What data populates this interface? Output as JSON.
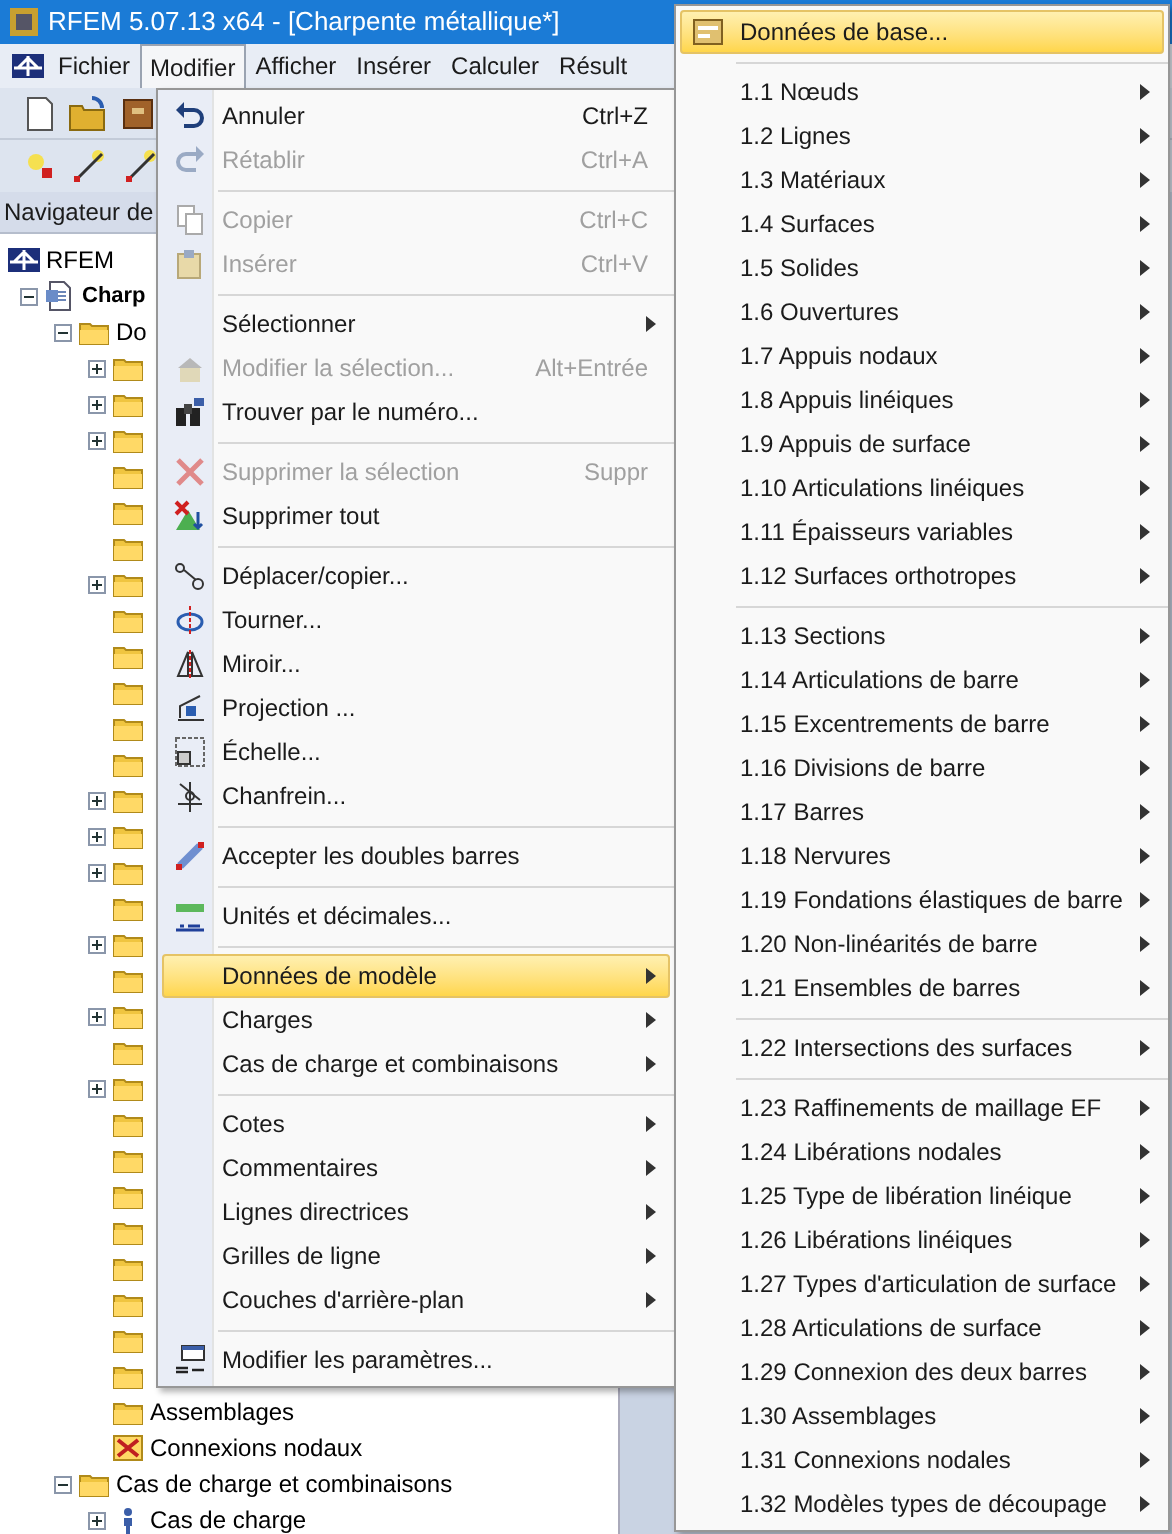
{
  "window": {
    "title": "RFEM 5.07.13 x64 - [Charpente métallique*]"
  },
  "menu_bar": [
    {
      "label": "Fichier",
      "selected": false
    },
    {
      "label": "Modifier",
      "selected": true
    },
    {
      "label": "Afficher",
      "selected": false
    },
    {
      "label": "Insérer",
      "selected": false
    },
    {
      "label": "Calculer",
      "selected": false
    },
    {
      "label": "Résult",
      "selected": false
    }
  ],
  "navigator": {
    "title": "Navigateur de",
    "tree": [
      {
        "label": "RFEM",
        "kind": "root",
        "children": [
          {
            "label": "Charp",
            "kind": "model",
            "bold": true,
            "expanded": true,
            "children": [
              {
                "label": "Do",
                "kind": "folder",
                "expanded": true,
                "children": [
                  {
                    "kind": "folder",
                    "expanded": false
                  },
                  {
                    "kind": "folder",
                    "expanded": false
                  },
                  {
                    "kind": "folder",
                    "expanded": false
                  },
                  {
                    "kind": "folder"
                  },
                  {
                    "kind": "folder"
                  },
                  {
                    "kind": "folder"
                  },
                  {
                    "kind": "folder",
                    "expanded": false
                  },
                  {
                    "kind": "folder"
                  },
                  {
                    "kind": "folder"
                  },
                  {
                    "kind": "folder"
                  },
                  {
                    "kind": "folder"
                  },
                  {
                    "kind": "folder"
                  },
                  {
                    "kind": "folder",
                    "expanded": false
                  },
                  {
                    "kind": "folder",
                    "expanded": false
                  },
                  {
                    "kind": "folder",
                    "expanded": false
                  },
                  {
                    "kind": "folder"
                  },
                  {
                    "kind": "folder",
                    "expanded": false
                  },
                  {
                    "kind": "folder"
                  },
                  {
                    "kind": "folder",
                    "expanded": false
                  },
                  {
                    "kind": "folder"
                  },
                  {
                    "kind": "folder",
                    "expanded": false
                  },
                  {
                    "kind": "folder"
                  },
                  {
                    "kind": "folder"
                  },
                  {
                    "kind": "folder"
                  },
                  {
                    "kind": "folder"
                  },
                  {
                    "kind": "folder"
                  },
                  {
                    "kind": "folder"
                  },
                  {
                    "kind": "folder"
                  },
                  {
                    "kind": "folder"
                  },
                  {
                    "label": "Assemblages",
                    "kind": "folder"
                  },
                  {
                    "label": "Connexions nodaux",
                    "kind": "joint"
                  }
                ]
              },
              {
                "label": "Cas de charge et combinaisons",
                "kind": "folder",
                "expanded": true,
                "children": [
                  {
                    "label": "Cas de charge",
                    "kind": "load-case",
                    "expanded": false
                  }
                ]
              }
            ]
          }
        ]
      }
    ]
  },
  "edit_menu": [
    {
      "kind": "item",
      "label": "Annuler",
      "shortcut": "Ctrl+Z",
      "disabled": false,
      "submenu": false,
      "selected": false
    },
    {
      "kind": "item",
      "label": "Rétablir",
      "shortcut": "Ctrl+A",
      "disabled": true,
      "submenu": false,
      "selected": false
    },
    {
      "kind": "separator"
    },
    {
      "kind": "item",
      "label": "Copier",
      "shortcut": "Ctrl+C",
      "disabled": true,
      "submenu": false,
      "selected": false
    },
    {
      "kind": "item",
      "label": "Insérer",
      "shortcut": "Ctrl+V",
      "disabled": true,
      "submenu": false,
      "selected": false
    },
    {
      "kind": "separator"
    },
    {
      "kind": "item",
      "label": "Sélectionner",
      "disabled": false,
      "submenu": true,
      "selected": false
    },
    {
      "kind": "item",
      "label": "Modifier la sélection...",
      "shortcut": "Alt+Entrée",
      "disabled": true,
      "submenu": false,
      "selected": false
    },
    {
      "kind": "item",
      "label": "Trouver par le numéro...",
      "disabled": false,
      "submenu": false,
      "selected": false
    },
    {
      "kind": "separator"
    },
    {
      "kind": "item",
      "label": "Supprimer la sélection",
      "shortcut": "Suppr",
      "disabled": true,
      "submenu": false,
      "selected": false
    },
    {
      "kind": "item",
      "label": "Supprimer tout",
      "disabled": false,
      "submenu": false,
      "selected": false
    },
    {
      "kind": "separator"
    },
    {
      "kind": "item",
      "label": "Déplacer/copier...",
      "disabled": false,
      "submenu": false,
      "selected": false
    },
    {
      "kind": "item",
      "label": "Tourner...",
      "disabled": false,
      "submenu": false,
      "selected": false
    },
    {
      "kind": "item",
      "label": "Miroir...",
      "disabled": false,
      "submenu": false,
      "selected": false
    },
    {
      "kind": "item",
      "label": "Projection ...",
      "disabled": false,
      "submenu": false,
      "selected": false
    },
    {
      "kind": "item",
      "label": "Échelle...",
      "disabled": false,
      "submenu": false,
      "selected": false
    },
    {
      "kind": "item",
      "label": "Chanfrein...",
      "disabled": false,
      "submenu": false,
      "selected": false
    },
    {
      "kind": "separator"
    },
    {
      "kind": "item",
      "label": "Accepter les doubles barres",
      "disabled": false,
      "submenu": false,
      "selected": false
    },
    {
      "kind": "separator"
    },
    {
      "kind": "item",
      "label": "Unités et décimales...",
      "disabled": false,
      "submenu": false,
      "selected": false
    },
    {
      "kind": "separator"
    },
    {
      "kind": "item",
      "label": "Données de modèle",
      "disabled": false,
      "submenu": true,
      "selected": true
    },
    {
      "kind": "item",
      "label": "Charges",
      "disabled": false,
      "submenu": true,
      "selected": false
    },
    {
      "kind": "item",
      "label": "Cas de charge et combinaisons",
      "disabled": false,
      "submenu": true,
      "selected": false
    },
    {
      "kind": "separator"
    },
    {
      "kind": "item",
      "label": "Cotes",
      "disabled": false,
      "submenu": true,
      "selected": false
    },
    {
      "kind": "item",
      "label": "Commentaires",
      "disabled": false,
      "submenu": true,
      "selected": false
    },
    {
      "kind": "item",
      "label": "Lignes directrices",
      "disabled": false,
      "submenu": true,
      "selected": false
    },
    {
      "kind": "item",
      "label": "Grilles de ligne",
      "disabled": false,
      "submenu": true,
      "selected": false
    },
    {
      "kind": "item",
      "label": "Couches d'arrière-plan",
      "disabled": false,
      "submenu": true,
      "selected": false
    },
    {
      "kind": "separator"
    },
    {
      "kind": "item",
      "label": "Modifier les paramètres...",
      "disabled": false,
      "submenu": false,
      "selected": false
    }
  ],
  "model_data_menu": [
    {
      "kind": "item",
      "label": "Données de base...",
      "submenu": false,
      "selected": true
    },
    {
      "kind": "separator"
    },
    {
      "kind": "item",
      "label": "1.1 Nœuds",
      "submenu": true,
      "selected": false
    },
    {
      "kind": "item",
      "label": "1.2 Lignes",
      "submenu": true,
      "selected": false
    },
    {
      "kind": "item",
      "label": "1.3 Matériaux",
      "submenu": true,
      "selected": false
    },
    {
      "kind": "item",
      "label": "1.4 Surfaces",
      "submenu": true,
      "selected": false
    },
    {
      "kind": "item",
      "label": "1.5 Solides",
      "submenu": true,
      "selected": false
    },
    {
      "kind": "item",
      "label": "1.6 Ouvertures",
      "submenu": true,
      "selected": false
    },
    {
      "kind": "item",
      "label": "1.7 Appuis nodaux",
      "submenu": true,
      "selected": false
    },
    {
      "kind": "item",
      "label": "1.8 Appuis linéiques",
      "submenu": true,
      "selected": false
    },
    {
      "kind": "item",
      "label": "1.9 Appuis de surface",
      "submenu": true,
      "selected": false
    },
    {
      "kind": "item",
      "label": "1.10 Articulations linéiques",
      "submenu": true,
      "selected": false
    },
    {
      "kind": "item",
      "label": "1.11 Épaisseurs variables",
      "submenu": true,
      "selected": false
    },
    {
      "kind": "item",
      "label": "1.12 Surfaces orthotropes",
      "submenu": true,
      "selected": false
    },
    {
      "kind": "separator"
    },
    {
      "kind": "item",
      "label": "1.13 Sections",
      "submenu": true,
      "selected": false
    },
    {
      "kind": "item",
      "label": "1.14 Articulations de barre",
      "submenu": true,
      "selected": false
    },
    {
      "kind": "item",
      "label": "1.15 Excentrements de barre",
      "submenu": true,
      "selected": false
    },
    {
      "kind": "item",
      "label": "1.16 Divisions de barre",
      "submenu": true,
      "selected": false
    },
    {
      "kind": "item",
      "label": "1.17 Barres",
      "submenu": true,
      "selected": false
    },
    {
      "kind": "item",
      "label": "1.18 Nervures",
      "submenu": true,
      "selected": false
    },
    {
      "kind": "item",
      "label": "1.19 Fondations élastiques de barre",
      "submenu": true,
      "selected": false
    },
    {
      "kind": "item",
      "label": "1.20 Non-linéarités de barre",
      "submenu": true,
      "selected": false
    },
    {
      "kind": "item",
      "label": "1.21 Ensembles de barres",
      "submenu": true,
      "selected": false
    },
    {
      "kind": "separator"
    },
    {
      "kind": "item",
      "label": "1.22 Intersections des surfaces",
      "submenu": true,
      "selected": false
    },
    {
      "kind": "separator"
    },
    {
      "kind": "item",
      "label": "1.23 Raffinements de maillage EF",
      "submenu": true,
      "selected": false
    },
    {
      "kind": "item",
      "label": "1.24 Libérations nodales",
      "submenu": true,
      "selected": false
    },
    {
      "kind": "item",
      "label": "1.25 Type de libération linéique",
      "submenu": true,
      "selected": false
    },
    {
      "kind": "item",
      "label": "1.26 Libérations linéiques",
      "submenu": true,
      "selected": false
    },
    {
      "kind": "item",
      "label": "1.27 Types d'articulation de surface",
      "submenu": true,
      "selected": false
    },
    {
      "kind": "item",
      "label": "1.28 Articulations de surface",
      "submenu": true,
      "selected": false
    },
    {
      "kind": "item",
      "label": "1.29 Connexion des deux barres",
      "submenu": true,
      "selected": false
    },
    {
      "kind": "item",
      "label": "1.30 Assemblages",
      "submenu": true,
      "selected": false
    },
    {
      "kind": "item",
      "label": "1.31 Connexions nodales",
      "submenu": true,
      "selected": false
    },
    {
      "kind": "item",
      "label": "1.32 Modèles types de découpage",
      "submenu": true,
      "selected": false
    }
  ]
}
